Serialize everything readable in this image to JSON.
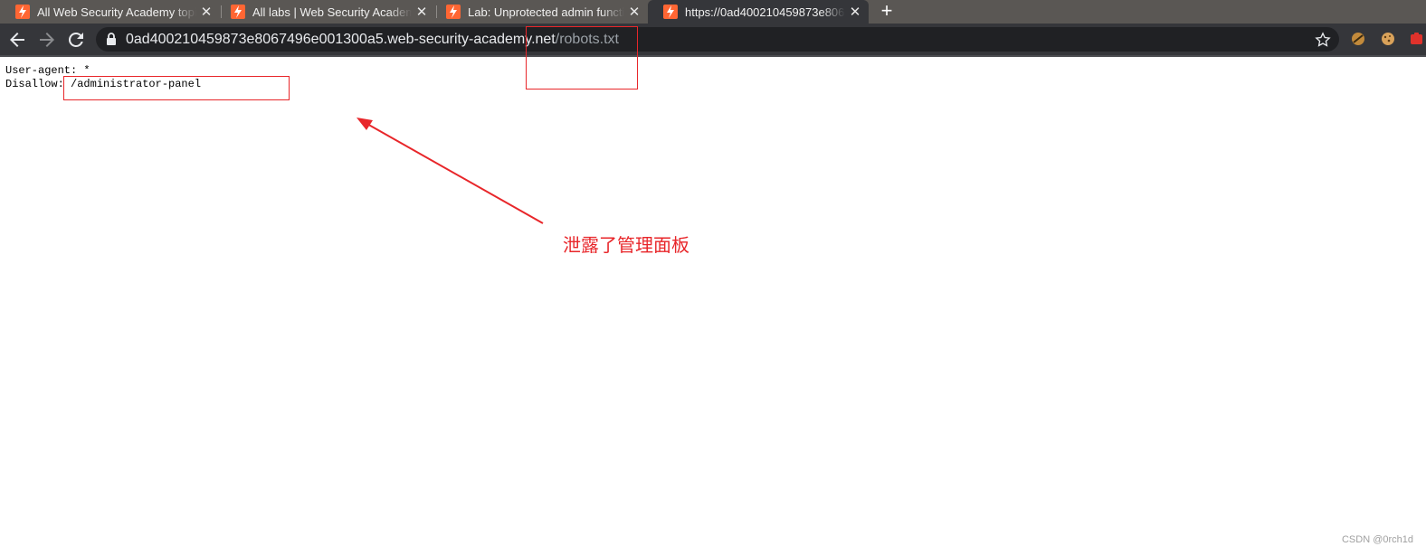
{
  "browser": {
    "tabs": [
      {
        "title": "All Web Security Academy topics",
        "active": false
      },
      {
        "title": "All labs | Web Security Academy",
        "active": false
      },
      {
        "title": "Lab: Unprotected admin functionality",
        "active": false
      },
      {
        "title": "https://0ad400210459873e8067496e001300a5.web-security-academy.net/robots.txt",
        "active": true
      }
    ],
    "new_tab_label": "+",
    "close_label": "✕",
    "address_bar": {
      "host": "0ad400210459873e8067496e001300a5.web-security-academy.net",
      "path": "/robots.txt"
    },
    "accent_color": "#ff6633"
  },
  "page": {
    "lines": [
      "User-agent: *",
      "Disallow: /administrator-panel"
    ]
  },
  "annotation": {
    "text": "泄露了管理面板",
    "color": "#e8262a"
  },
  "watermark": "CSDN @0rch1d"
}
